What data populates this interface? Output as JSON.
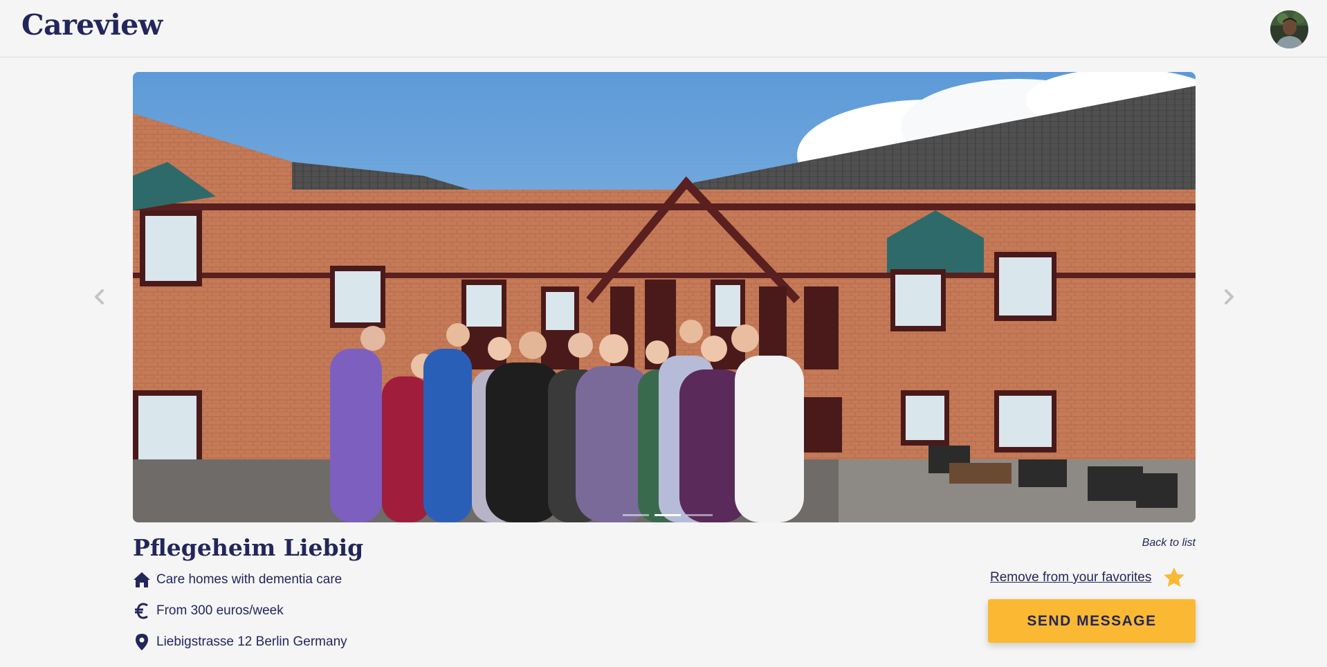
{
  "header": {
    "app_title": "Careview",
    "avatar_icon": "user-avatar"
  },
  "carousel": {
    "slide_count": 3,
    "active_slide": 1,
    "prev_icon": "chevron-left-icon",
    "next_icon": "chevron-right-icon"
  },
  "listing": {
    "name": "Pflegeheim Liebig",
    "category": "Care homes with dementia care",
    "price": "From 300 euros/week",
    "address": "Liebigstrasse 12 Berlin Germany"
  },
  "actions": {
    "back_label": "Back to list",
    "favorite_label": "Remove from your favorites",
    "send_label": "SEND MESSAGE",
    "favorite_active": true
  },
  "colors": {
    "brand": "#23265a",
    "accent": "#fbb832",
    "background": "#f5f5f5"
  }
}
